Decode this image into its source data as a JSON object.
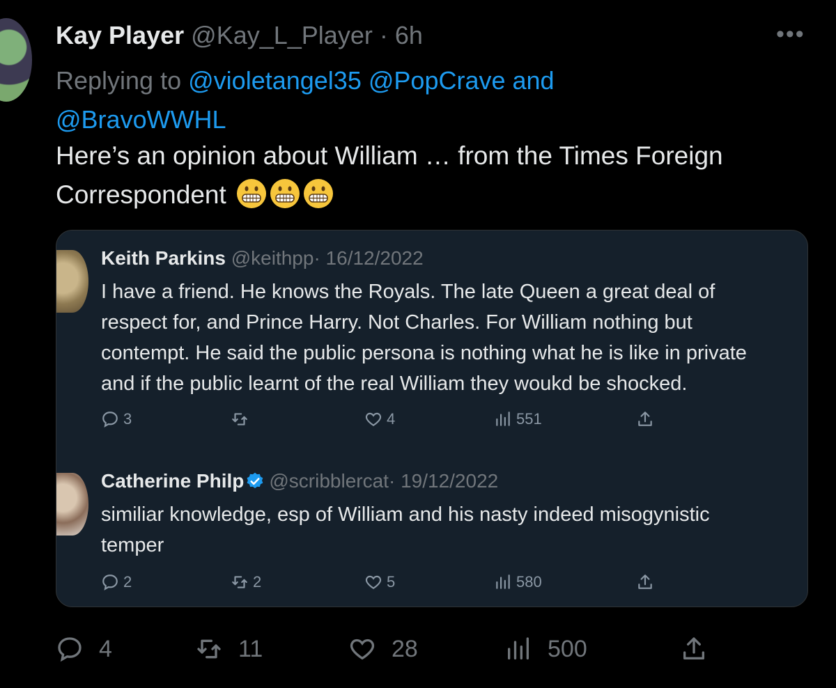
{
  "tweet": {
    "author_name": "Kay Player",
    "handle": "@Kay_L_Player",
    "time": "· 6h",
    "more": "•••",
    "replying_prefix": "Replying to",
    "reply_users": [
      "@violetangel35",
      "@PopCrave",
      "@BravoWWHL"
    ],
    "reply_and": "and",
    "text_line1": "Here’s an opinion about William … from the Times Foreign",
    "text_line2": "Correspondent",
    "emoji": "grimacing-face",
    "stats": {
      "replies": "4",
      "retweets": "11",
      "likes": "28",
      "views": "500"
    }
  },
  "quoted": [
    {
      "name": "Keith Parkins",
      "handle": "@keithpp",
      "date": "· 16/12/2022",
      "lines": [
        "I have a friend. He knows the Royals. The late Queen a great deal of",
        "respect for, and Prince Harry. Not Charles. For William nothing but",
        "contempt. He said the public persona is nothing what he is like in private",
        "and if the public learnt of the real William they woukd be shocked."
      ],
      "stats": {
        "replies": "3",
        "retweets": "",
        "likes": "4",
        "views": "551"
      }
    },
    {
      "name": "Catherine Philp",
      "handle": "@scribblercat",
      "date": "· 19/12/2022",
      "verified": true,
      "lines": [
        "similiar knowledge, esp of William and his nasty indeed misogynistic",
        "temper"
      ],
      "stats": {
        "replies": "2",
        "retweets": "2",
        "likes": "5",
        "views": "580"
      }
    }
  ],
  "colors": {
    "background": "#000000",
    "link": "#1d9bf0",
    "card": "#15202b",
    "muted": "#71767b"
  }
}
